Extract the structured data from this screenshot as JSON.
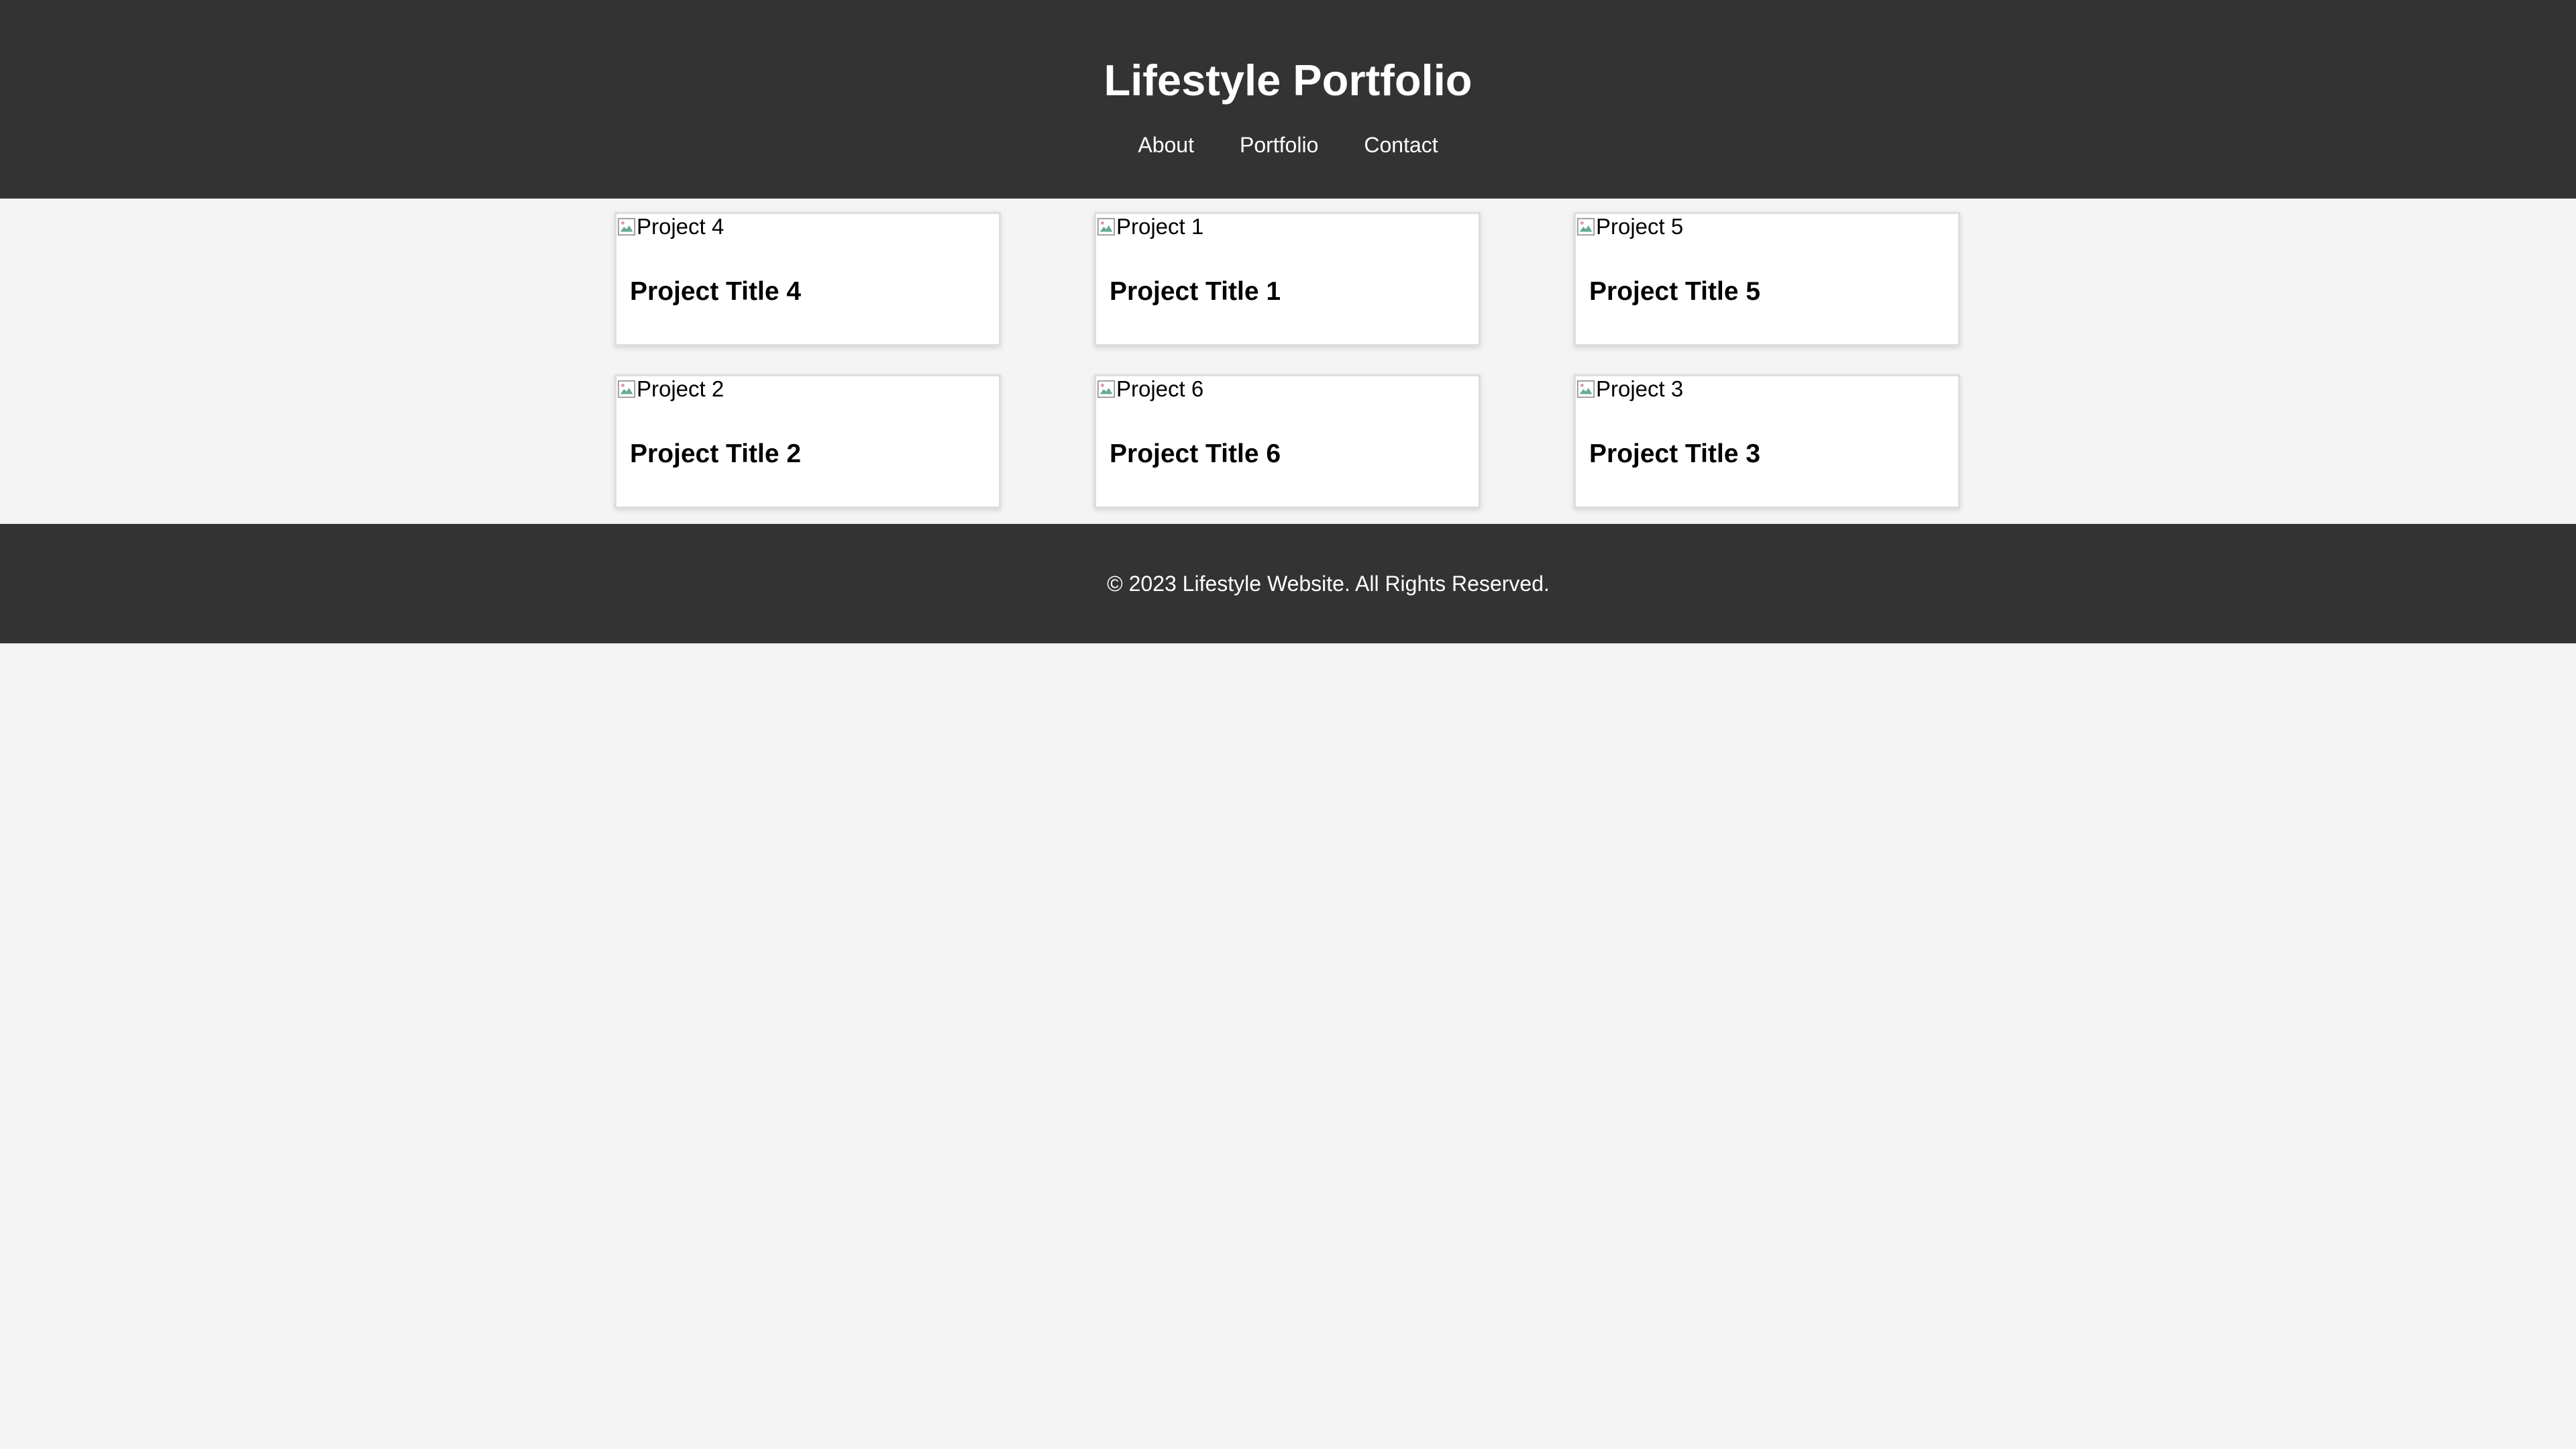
{
  "header": {
    "title": "Lifestyle Portfolio",
    "nav": [
      {
        "label": "About"
      },
      {
        "label": "Portfolio"
      },
      {
        "label": "Contact"
      }
    ]
  },
  "projects": [
    {
      "alt": "Project 4",
      "title": "Project Title 4"
    },
    {
      "alt": "Project 1",
      "title": "Project Title 1"
    },
    {
      "alt": "Project 5",
      "title": "Project Title 5"
    },
    {
      "alt": "Project 2",
      "title": "Project Title 2"
    },
    {
      "alt": "Project 6",
      "title": "Project Title 6"
    },
    {
      "alt": "Project 3",
      "title": "Project Title 3"
    }
  ],
  "footer": {
    "copyright": "© 2023 Lifestyle Website. All Rights Reserved."
  }
}
